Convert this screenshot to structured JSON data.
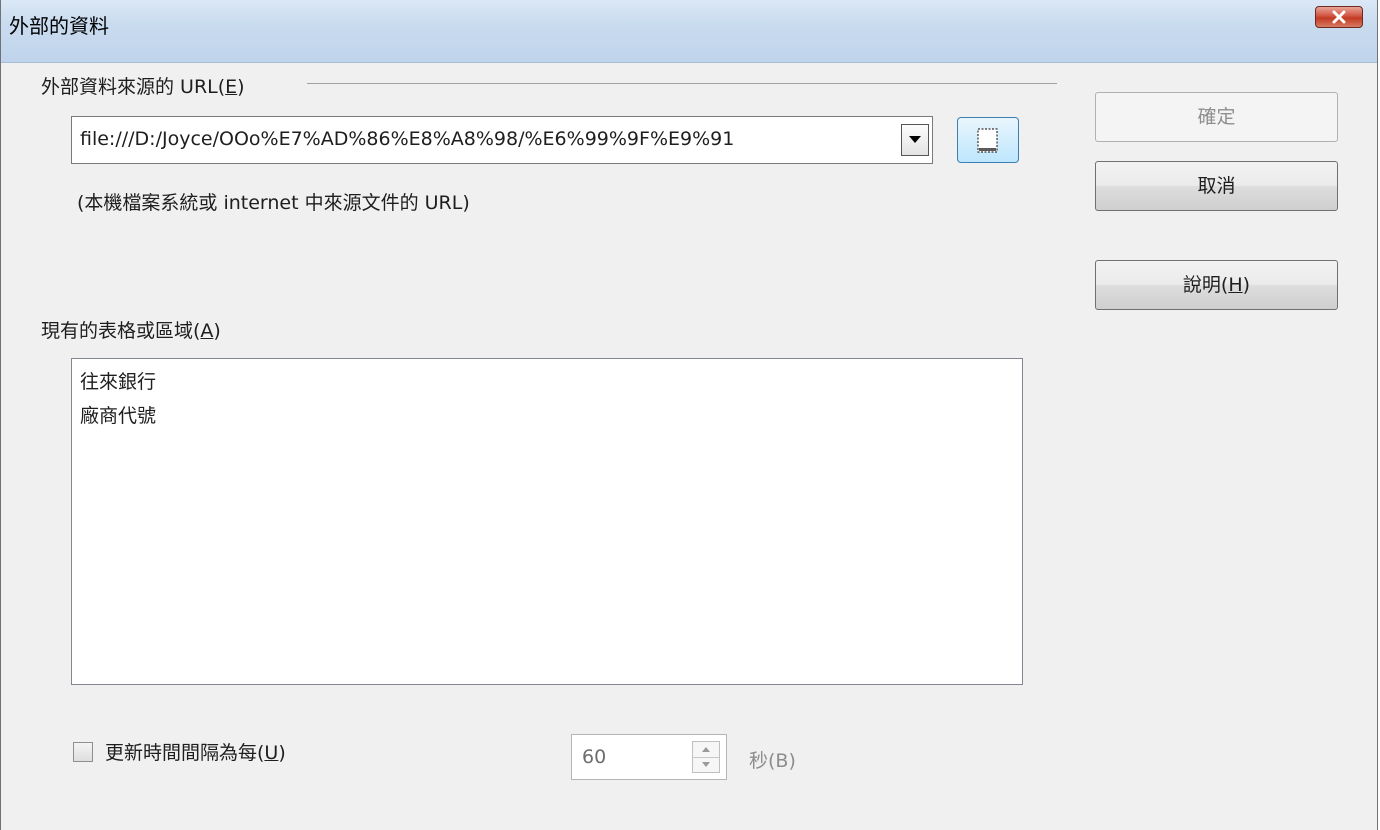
{
  "window": {
    "title": "外部的資料"
  },
  "url_group": {
    "label_prefix": "外部資料來源的 URL(",
    "label_mnemonic": "E",
    "label_suffix": ")",
    "url_value": "file:///D:/Joyce/OOo%E7%AD%86%E8%A8%98/%E6%99%9F%E9%91",
    "hint": "(本機檔案系統或 internet 中來源文件的 URL)"
  },
  "tables": {
    "label_prefix": "現有的表格或區域(",
    "label_mnemonic": "A",
    "label_suffix": ")",
    "items": [
      "往來銀行",
      "廠商代號"
    ]
  },
  "refresh": {
    "checked": false,
    "label_prefix": "更新時間間隔為每(",
    "label_mnemonic": "U",
    "label_suffix": ")",
    "interval_value": "60",
    "unit_label": "秒(B)"
  },
  "buttons": {
    "ok": "確定",
    "cancel": "取消",
    "help_prefix": "說明(",
    "help_mnemonic": "H",
    "help_suffix": ")"
  },
  "icons": {
    "close": "close-icon",
    "dropdown": "chevron-down-icon",
    "browse": "browse-file-icon",
    "spin_up": "spin-up-icon",
    "spin_down": "spin-down-icon"
  }
}
